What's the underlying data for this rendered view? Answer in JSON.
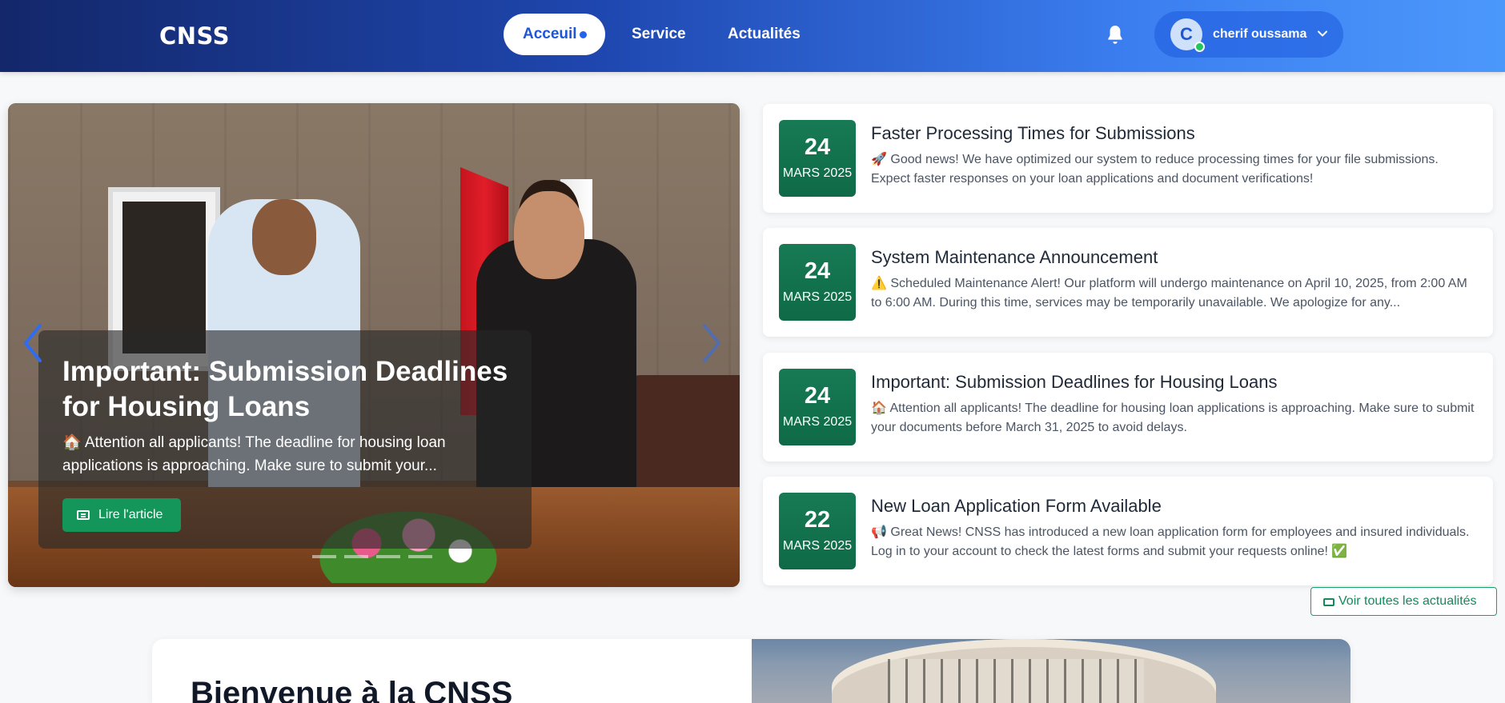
{
  "navbar": {
    "brand": "CNSS",
    "links": [
      {
        "label": "Acceuil",
        "active": true
      },
      {
        "label": "Service"
      },
      {
        "label": "Actualités"
      }
    ],
    "user": {
      "initial": "C",
      "name": "cherif oussama"
    },
    "icons": {
      "bell": "bell-icon",
      "chevron": "chevron-down-icon"
    }
  },
  "hero": {
    "title": "Important: Submission Deadlines for Housing Loans",
    "text": "🏠 Attention all applicants! The deadline for housing loan applications is approaching. Make sure to submit your...",
    "button_label": "Lire l'article"
  },
  "news": [
    {
      "day": "24",
      "month": "MARS 2025",
      "title": "Faster Processing Times for Submissions",
      "body": "🚀 Good news! We have optimized our system to reduce processing times for your file submissions. Expect faster responses on your loan applications and document verifications!"
    },
    {
      "day": "24",
      "month": "MARS 2025",
      "title": "System Maintenance Announcement",
      "body": "⚠️ Scheduled Maintenance Alert! Our platform will undergo maintenance on April 10, 2025, from 2:00 AM to 6:00 AM. During this time, services may be temporarily unavailable. We apologize for any..."
    },
    {
      "day": "24",
      "month": "MARS 2025",
      "title": "Important: Submission Deadlines for Housing Loans",
      "body": "🏠 Attention all applicants! The deadline for housing loan applications is approaching. Make sure to submit your documents before March 31, 2025 to avoid delays."
    },
    {
      "day": "22",
      "month": "MARS 2025",
      "title": "New Loan Application Form Available",
      "body": "📢 Great News! CNSS has introduced a new loan application form for employees and insured individuals. Log in to your account to check the latest forms and submit your requests online! ✅"
    }
  ],
  "all_news_label": "Voir toutes les actualités",
  "welcome": {
    "title": "Bienvenue à la CNSS"
  },
  "colors": {
    "accent_green": "#14965a",
    "nav_dark": "#13276a",
    "nav_light": "#4b98fb"
  }
}
